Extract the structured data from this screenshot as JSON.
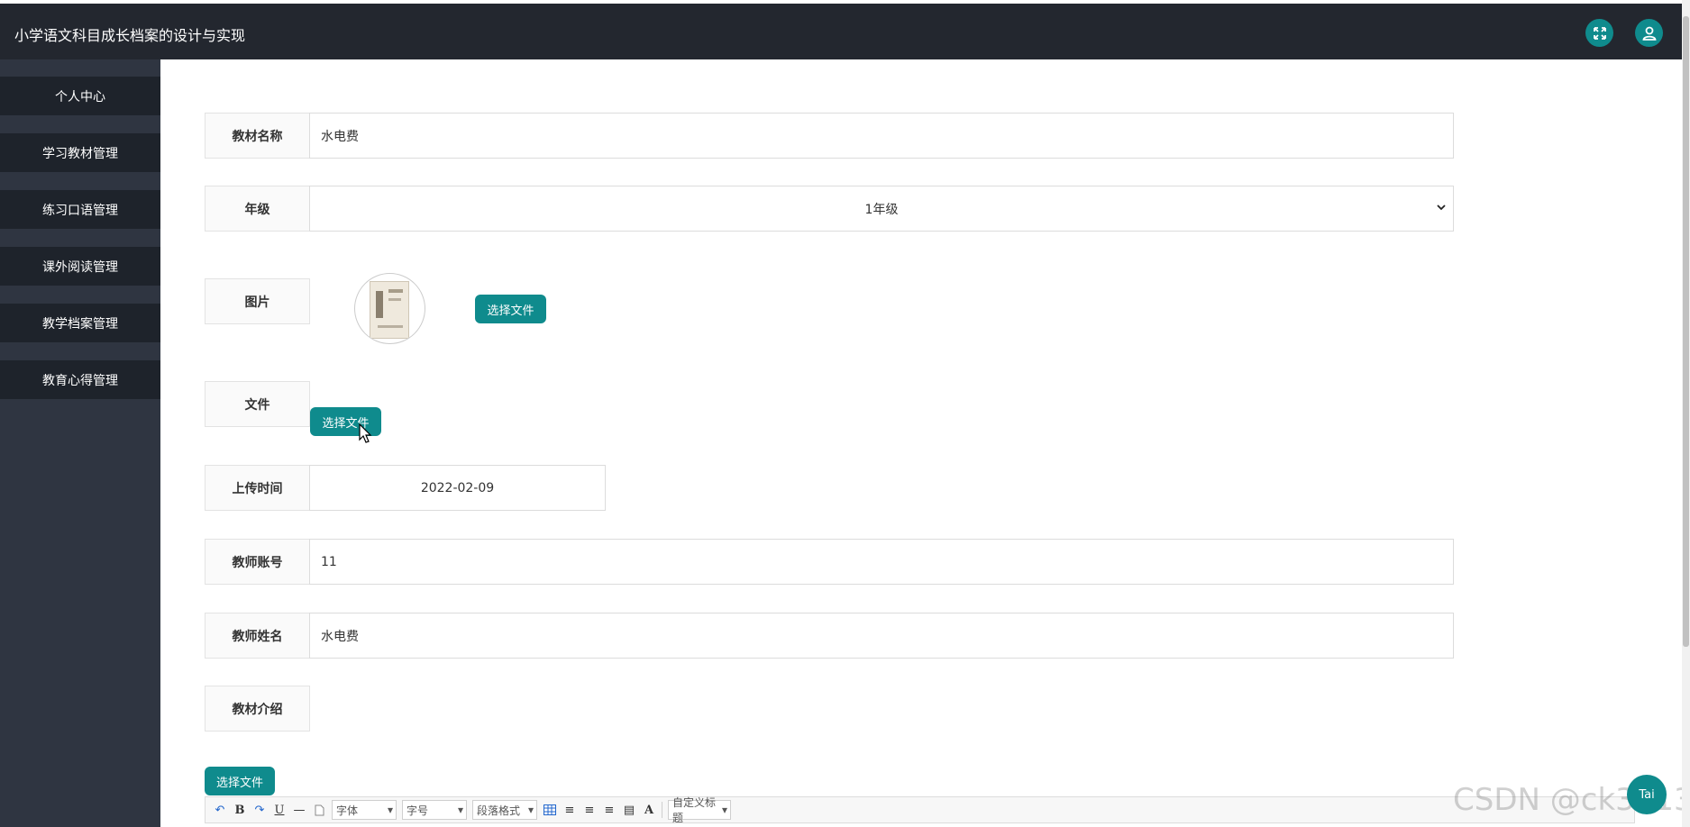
{
  "app": {
    "title": "小学语文科目成长档案的设计与实现"
  },
  "header": {
    "fullscreen_icon": "fullscreen-icon",
    "user_icon": "user-icon"
  },
  "sidebar": {
    "items": [
      {
        "label": "个人中心"
      },
      {
        "label": "学习教材管理"
      },
      {
        "label": "练习口语管理"
      },
      {
        "label": "课外阅读管理"
      },
      {
        "label": "教学档案管理"
      },
      {
        "label": "教育心得管理"
      }
    ]
  },
  "form": {
    "textbook_name": {
      "label": "教材名称",
      "value": "水电费"
    },
    "grade": {
      "label": "年级",
      "value": "1年级"
    },
    "image": {
      "label": "图片",
      "button": "选择文件"
    },
    "file": {
      "label": "文件",
      "button": "选择文件"
    },
    "upload_time": {
      "label": "上传时间",
      "value": "2022-02-09"
    },
    "teacher_account": {
      "label": "教师账号",
      "value": "11"
    },
    "teacher_name": {
      "label": "教师姓名",
      "value": "水电费"
    },
    "intro": {
      "label": "教材介绍",
      "button": "选择文件"
    }
  },
  "editor_toolbar": {
    "font_family": "字体",
    "font_size": "字号",
    "paragraph": "段落格式",
    "custom_title": "自定义标题",
    "font_color_glyph": "A"
  },
  "floating": {
    "label": "Tai"
  },
  "watermark": "CSDN @ck3013"
}
